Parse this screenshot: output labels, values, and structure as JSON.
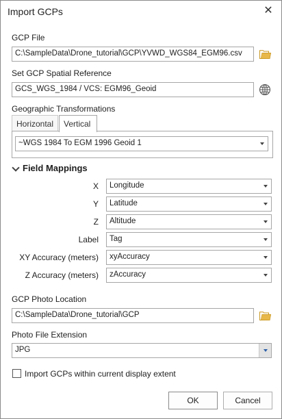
{
  "window": {
    "title": "Import GCPs"
  },
  "gcp_file": {
    "label": "GCP File",
    "value": "C:\\SampleData\\Drone_tutorial\\GCP\\YVWD_WGS84_EGM96.csv"
  },
  "spatial_reference": {
    "label": "Set GCP Spatial Reference",
    "value": "GCS_WGS_1984 / VCS: EGM96_Geoid"
  },
  "transformations": {
    "label": "Geographic Transformations",
    "tabs": [
      "Horizontal",
      "Vertical"
    ],
    "active_tab": "Vertical",
    "value": "~WGS 1984 To EGM 1996 Geoid 1"
  },
  "field_mappings": {
    "label": "Field Mappings",
    "rows": [
      {
        "label": "X",
        "value": "Longitude"
      },
      {
        "label": "Y",
        "value": "Latitude"
      },
      {
        "label": "Z",
        "value": "Altitude"
      },
      {
        "label": "Label",
        "value": "Tag"
      },
      {
        "label": "XY Accuracy (meters)",
        "value": "xyAccuracy"
      },
      {
        "label": "Z Accuracy (meters)",
        "value": "zAccuracy"
      }
    ]
  },
  "photo_location": {
    "label": "GCP Photo Location",
    "value": "C:\\SampleData\\Drone_tutorial\\GCP"
  },
  "photo_extension": {
    "label": "Photo File Extension",
    "value": "JPG"
  },
  "extent_option": {
    "label": "Import GCPs within current display extent",
    "checked": false
  },
  "buttons": {
    "ok": "OK",
    "cancel": "Cancel"
  },
  "colors": {
    "folder": "#e8b84a",
    "accent": "#2b5fa8"
  },
  "icons": {
    "folder": "folder-icon",
    "globe": "globe-icon",
    "close": "close-icon"
  }
}
